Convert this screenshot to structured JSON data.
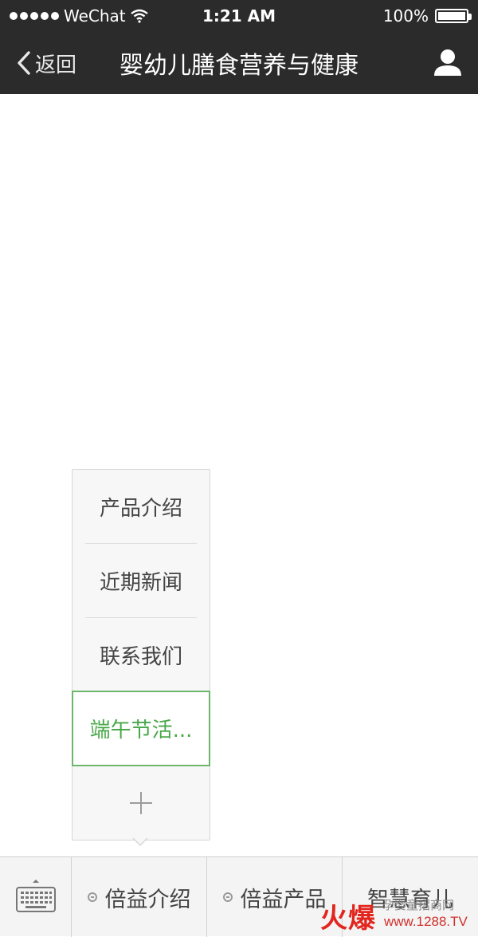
{
  "status_bar": {
    "carrier": "WeChat",
    "time": "1:21 AM",
    "battery": "100%",
    "battery_level": 1.0,
    "wifi_icon": "wifi-icon",
    "signal_icon": "signal-dots-icon"
  },
  "nav": {
    "back_label": "返回",
    "title": "婴幼儿膳食营养与健康",
    "back_icon": "chevron-left-icon",
    "profile_icon": "person-icon"
  },
  "submenu": {
    "items": [
      {
        "label": "产品介绍",
        "active": false
      },
      {
        "label": "近期新闻",
        "active": false
      },
      {
        "label": "联系我们",
        "active": false
      },
      {
        "label": "端午节活...",
        "active": true
      }
    ],
    "add_icon": "plus-icon"
  },
  "bottom_menu": {
    "keyboard_icon": "keyboard-icon",
    "items": [
      {
        "label": "倍益介绍",
        "icon": "submenu-dot-icon"
      },
      {
        "label": "倍益产品",
        "icon": "submenu-dot-icon"
      },
      {
        "label": "智慧育儿"
      }
    ]
  },
  "watermark": {
    "brand": "火爆",
    "subtitle": "孕婴童招商网",
    "url": "www.1288.TV"
  },
  "colors": {
    "header_bg": "#2b2b2b",
    "active_green": "#4aa84a",
    "active_border": "#6cb66c",
    "menu_bg": "#f4f4f4"
  }
}
